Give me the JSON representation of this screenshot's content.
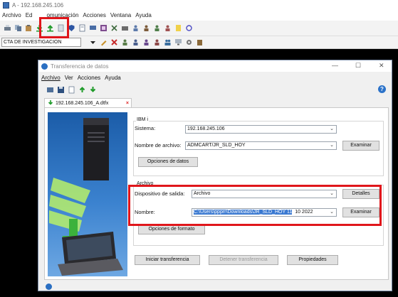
{
  "window": {
    "title": "A - 192.168.245.106"
  },
  "menubar": {
    "items": [
      {
        "label": "Archivo"
      },
      {
        "label": "Ed"
      },
      {
        "label": "omunicación"
      },
      {
        "label": "Acciones"
      },
      {
        "label": "Ventana"
      },
      {
        "label": "Ayuda"
      }
    ]
  },
  "toolbar2": {
    "session": "CTA DE INVESTIGACION"
  },
  "dialog": {
    "title": "Transferencia de datos",
    "menubar": [
      {
        "label": "Archivo"
      },
      {
        "label": "Ver"
      },
      {
        "label": "Acciones"
      },
      {
        "label": "Ayuda"
      }
    ],
    "help_icon": "?",
    "tab": {
      "label": "192.168.245.106_A.dtfx",
      "close": "×"
    },
    "ibmi": {
      "group_title": "IBM i",
      "sistema_label": "Sistema:",
      "sistema_value": "192.168.245.106",
      "archivo_label": "Nombre de archivo:",
      "archivo_value": "ADMCART/JR_SLD_HOY",
      "examinar": "Examinar",
      "opciones_datos": "Opciones de datos"
    },
    "archivo": {
      "group_title": "Archivo",
      "dispositivo_label": "Dispositivo de salida:",
      "dispositivo_value": "Archivo",
      "detalles": "Detalles",
      "nombre_label": "Nombre:",
      "nombre_selected": "C:\\Users\\ppprr\\Downloads\\JR_SLD_HOY 11",
      "nombre_rest": "10 2022",
      "examinar": "Examinar",
      "opciones_formato": "Opciones de formato"
    },
    "buttons": {
      "iniciar": "Iniciar transferencia",
      "detener": "Detener transferencia",
      "propiedades": "Propiedades"
    }
  },
  "colors": {
    "highlight": "#e0161b",
    "selection": "#3a79d1",
    "terminal": "#000000"
  }
}
